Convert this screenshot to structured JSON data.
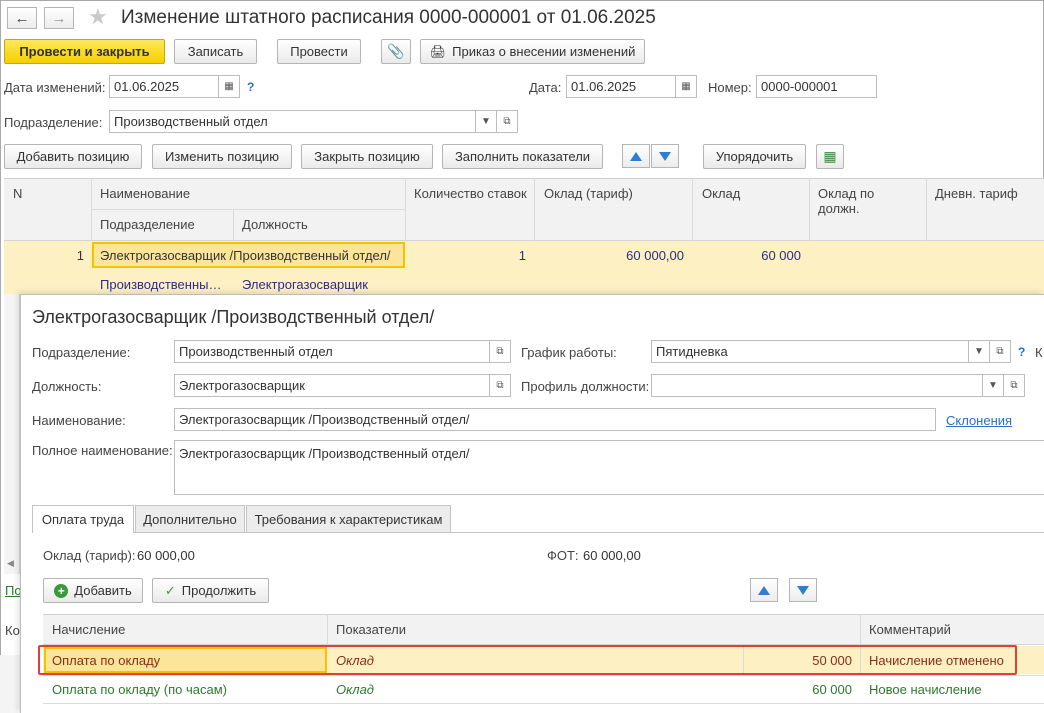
{
  "window": {
    "title": "Изменение штатного расписания 0000-000001 от 01.06.2025"
  },
  "toolbar": {
    "post_close": "Провести и закрыть",
    "save": "Записать",
    "post": "Провести",
    "order": "Приказ о внесении изменений"
  },
  "header": {
    "change_date_label": "Дата изменений:",
    "change_date": "01.06.2025",
    "help": "?",
    "date_label": "Дата:",
    "date": "01.06.2025",
    "number_label": "Номер:",
    "number": "0000-000001",
    "department_label": "Подразделение:",
    "department": "Производственный отдел"
  },
  "positions_toolbar": {
    "add": "Добавить позицию",
    "edit": "Изменить позицию",
    "close": "Закрыть позицию",
    "fill": "Заполнить показатели",
    "sort": "Упорядочить"
  },
  "grid": {
    "col_n": "N",
    "col_name": "Наименование",
    "col_dept": "Подразделение",
    "col_post": "Должность",
    "col_rates": "Количество ставок",
    "col_salary_tariff": "Оклад (тариф)",
    "col_salary": "Оклад",
    "col_salary_post": "Оклад по должн.",
    "col_day_tariff": "Дневн. тариф",
    "row": {
      "n": "1",
      "name": "Электрогазосварщик /Производственный отдел/",
      "dept": "Производственны…",
      "post": "Электрогазосварщик",
      "rates": "1",
      "salary_tariff": "60 000,00",
      "salary": "60 000"
    }
  },
  "left_stubs": {
    "link": "По",
    "label": "Ко"
  },
  "dialog": {
    "title": "Электрогазосварщик /Производственный отдел/",
    "department_label": "Подразделение:",
    "department": "Производственный отдел",
    "schedule_label": "График работы:",
    "schedule": "Пятидневка",
    "schedule_help": "?",
    "schedule_cut": "К",
    "post_label": "Должность:",
    "post": "Электрогазосварщик",
    "profile_label": "Профиль должности:",
    "profile": "",
    "name_label": "Наименование:",
    "name": "Электрогазосварщик /Производственный отдел/",
    "declensions": "Склонения",
    "full_name_label": "Полное наименование:",
    "full_name": "Электрогазосварщик /Производственный отдел/",
    "tabs": [
      "Оплата труда",
      "Дополнительно",
      "Требования к характеристикам"
    ],
    "salary_label": "Оклад (тариф):",
    "salary": "60 000,00",
    "fot_label": "ФОТ:",
    "fot": "60 000,00",
    "add": "Добавить",
    "continue": "Продолжить",
    "accruals": {
      "col_accrual": "Начисление",
      "col_indicators": "Показатели",
      "col_comment": "Комментарий",
      "rows": [
        {
          "accrual": "Оплата по окладу",
          "indicator": "Оклад",
          "value": "50 000",
          "comment": "Начисление отменено"
        },
        {
          "accrual": "Оплата по окладу (по часам)",
          "indicator": "Оклад",
          "value": "60 000",
          "comment": "Новое начисление"
        }
      ]
    }
  },
  "colors": {
    "primary_button": "#f4cf00",
    "selected_row": "#fdf1c4",
    "cancelled_text": "#8b2b1b",
    "new_text": "#2d7a2d",
    "highlight_border": "#e0403a",
    "link": "#2a6fc9"
  }
}
